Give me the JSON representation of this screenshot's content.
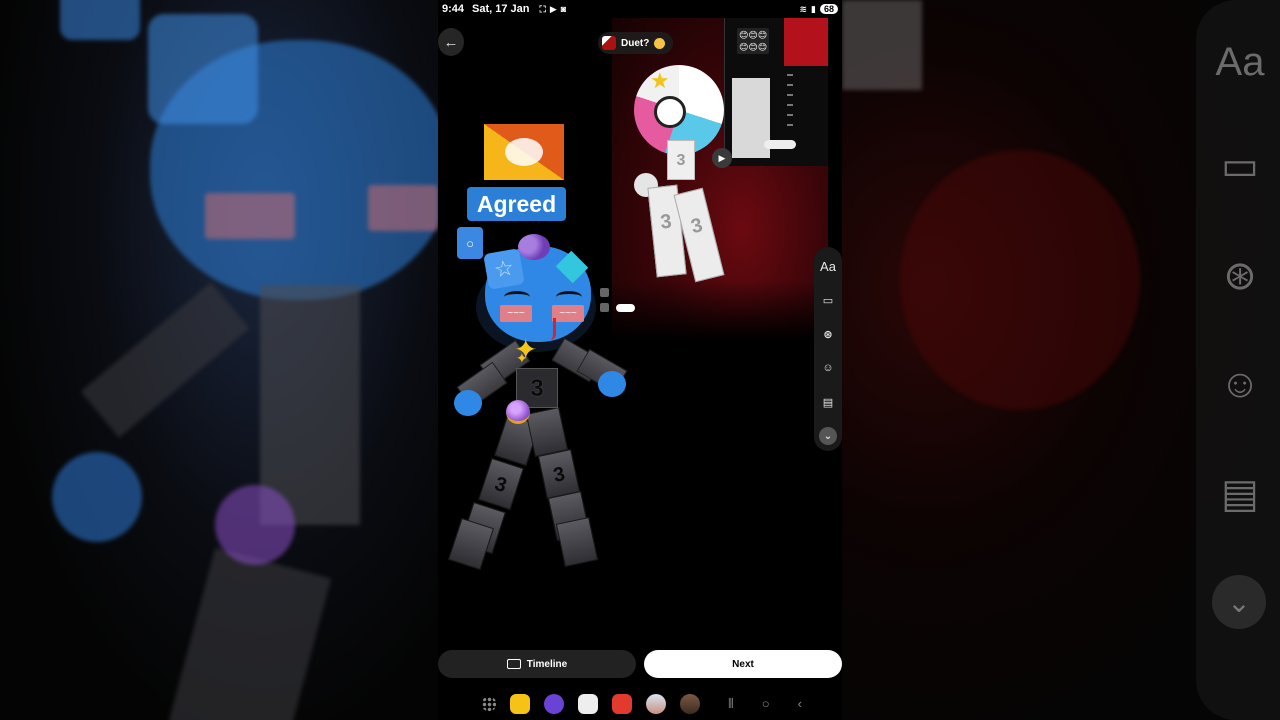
{
  "status_bar": {
    "time": "9:44",
    "date": "Sat, 17 Jan",
    "battery": "68"
  },
  "header": {
    "back_icon": "arrow-left-icon",
    "duet_chip_label": "Duet?"
  },
  "stickers": {
    "agreed_label": "Agreed",
    "flag": "bhutan-flag",
    "char_digit": "3"
  },
  "tool_rail": {
    "items": [
      {
        "name": "text-tool",
        "label": "Aa"
      },
      {
        "name": "split-clip-icon",
        "label": "▯⃞"
      },
      {
        "name": "effects-icon",
        "label": "⊛"
      },
      {
        "name": "sticker-icon",
        "label": "☺"
      },
      {
        "name": "captions-icon",
        "label": "▤"
      },
      {
        "name": "chevron-down-icon",
        "label": "⌄"
      }
    ]
  },
  "bottom_actions": {
    "timeline_label": "Timeline",
    "next_label": "Next"
  },
  "colors": {
    "accent_blue": "#2c7fd6",
    "next_bg": "#ffffff",
    "timeline_bg": "#222222"
  }
}
